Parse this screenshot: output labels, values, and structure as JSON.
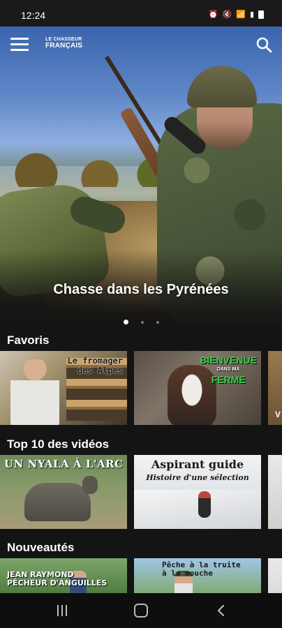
{
  "status_bar": {
    "time": "12:24",
    "icons": [
      "alarm-icon",
      "mute-icon",
      "wifi-icon",
      "signal-icon",
      "battery-icon"
    ]
  },
  "app": {
    "logo_line1": "LE CHASSEUR",
    "logo_line2": "FRANÇAIS"
  },
  "hero": {
    "title": "Chasse dans les Pyrénées",
    "slides_count": 3,
    "active_slide": 1
  },
  "sections": [
    {
      "title": "Favoris",
      "items": [
        {
          "text": "Le fromager\ndes Alpes"
        },
        {
          "text": "BIENVENUE",
          "text_small": "DANS MA",
          "text2": "FERME"
        },
        {
          "text": "V"
        }
      ]
    },
    {
      "title": "Top 10 des vidéos",
      "items": [
        {
          "text": "UN NYALA À L'ARC"
        },
        {
          "text": "Aspirant guide",
          "text2": "Histoire d'une sélection"
        },
        {
          "text": ""
        }
      ]
    },
    {
      "title": "Nouveautés",
      "items": [
        {
          "text": "JEAN RAYMOND\nPÊCHEUR D'ANGUILLES"
        },
        {
          "text": "Pêche à la truite\nà la mouche"
        },
        {
          "text": ""
        }
      ]
    }
  ],
  "colors": {
    "background": "#141414",
    "ferme_title": "#3ad14a"
  }
}
